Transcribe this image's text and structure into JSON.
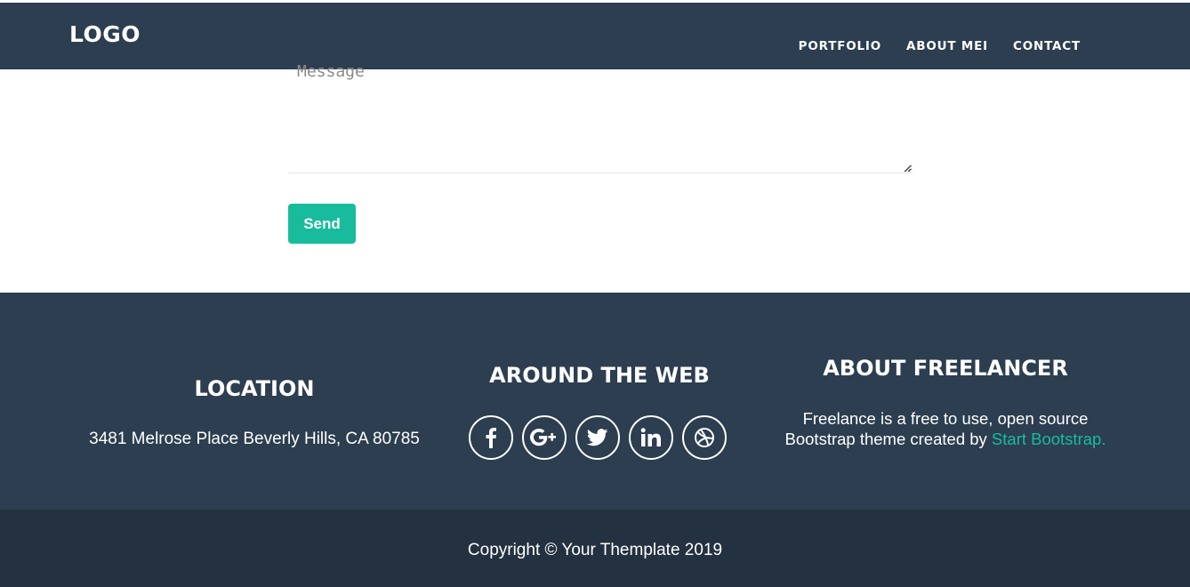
{
  "navbar": {
    "logo": "LOGO",
    "links": [
      "PORTFOLIO",
      "ABOUT MEI",
      "CONTACT"
    ]
  },
  "form": {
    "message_placeholder": "Message",
    "send_label": "Send"
  },
  "footer": {
    "location": {
      "title": "LOCATION",
      "address": "3481 Melrose Place Beverly Hills, CA 80785"
    },
    "web": {
      "title": "AROUND THE WEB",
      "icons": [
        "facebook-icon",
        "google-plus-icon",
        "twitter-icon",
        "linkedin-icon",
        "dribbble-icon"
      ]
    },
    "about": {
      "title": "ABOUT FREELANCER",
      "text": "Freelance is a free to use, open source Bootstrap theme created by ",
      "link": "Start Bootstrap."
    }
  },
  "copyright": "Copyright © Your Themplate 2019",
  "colors": {
    "primary": "#2c3e50",
    "dark": "#233140",
    "accent": "#18bc9c"
  }
}
